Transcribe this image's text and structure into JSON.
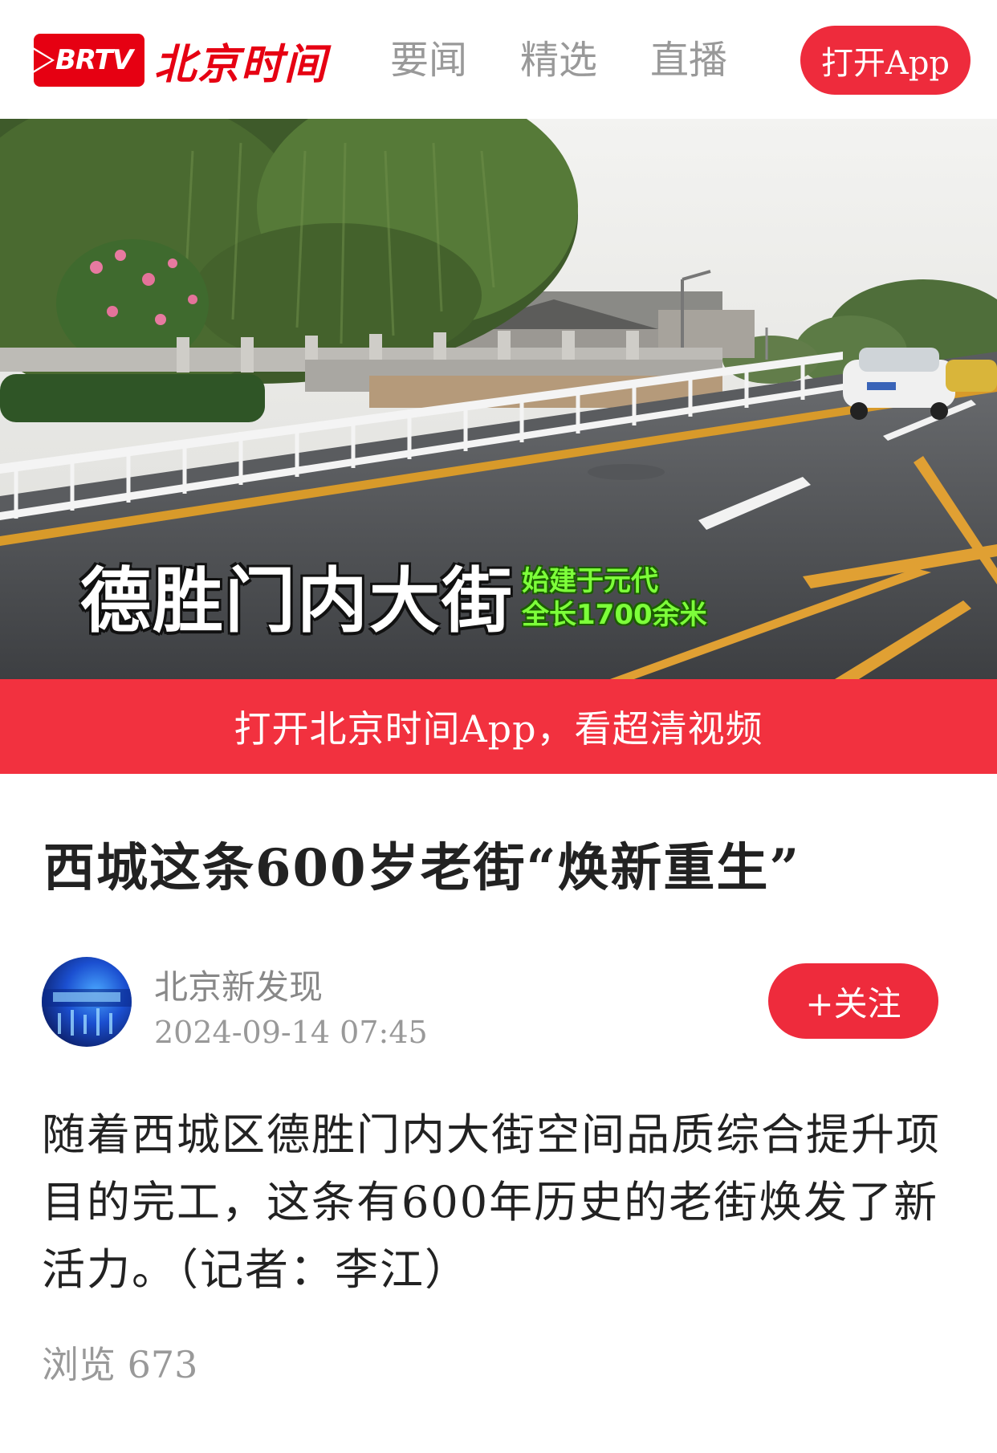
{
  "header": {
    "logo_badge": "BRTV",
    "logo_text": "北京时间",
    "nav": [
      "要闻",
      "精选",
      "直播"
    ],
    "open_app_button": "打开App"
  },
  "hero": {
    "caption_main": "德胜门内大街",
    "caption_sub_1": "始建于元代",
    "caption_sub_2": "全长1700余米"
  },
  "banner": {
    "text": "打开北京时间App，看超清视频"
  },
  "article": {
    "title": "西城这条600岁老街“焕新重生”",
    "author": "北京新发现",
    "date": "2024-09-14  07:45",
    "follow_button": "+关注",
    "body": "随着西城区德胜门内大街空间品质综合提升项目的完工，这条有600年历史的老街焕发了新活力。（记者：李江）",
    "views": "浏览 673"
  },
  "colors": {
    "brand_red": "#e60012",
    "button_red": "#ee2b3c",
    "banner_red": "#f2313f",
    "caption_green": "#7dff3a"
  }
}
